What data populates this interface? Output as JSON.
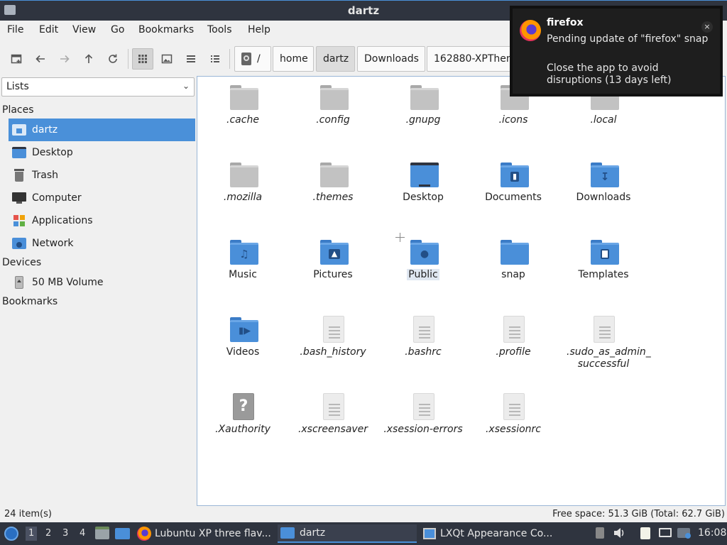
{
  "window": {
    "title": "dartz"
  },
  "menu": [
    "File",
    "Edit",
    "View",
    "Go",
    "Bookmarks",
    "Tools",
    "Help"
  ],
  "toolbar": {
    "breadcrumbs": [
      {
        "label": "/",
        "icon": "drive-icon"
      },
      {
        "label": "home"
      },
      {
        "label": "dartz",
        "current": true
      },
      {
        "label": "Downloads"
      },
      {
        "label": "162880-XPThem"
      }
    ]
  },
  "side": {
    "select_value": "Lists",
    "places_heading": "Places",
    "places": [
      "dartz",
      "Desktop",
      "Trash",
      "Computer",
      "Applications",
      "Network"
    ],
    "devices_heading": "Devices",
    "devices": [
      "50 MB Volume"
    ],
    "bookmarks_heading": "Bookmarks"
  },
  "files": [
    {
      "name": ".cache",
      "type": "folder-grey"
    },
    {
      "name": ".config",
      "type": "folder-grey"
    },
    {
      "name": ".gnupg",
      "type": "folder-grey"
    },
    {
      "name": ".icons",
      "type": "folder-grey"
    },
    {
      "name": ".local",
      "type": "folder-grey"
    },
    {
      "name": ".mozilla",
      "type": "folder-grey"
    },
    {
      "name": ".themes",
      "type": "folder-grey"
    },
    {
      "name": "Desktop",
      "type": "folder-desktop"
    },
    {
      "name": "Documents",
      "type": "folder-documents"
    },
    {
      "name": "Downloads",
      "type": "folder-downloads"
    },
    {
      "name": "Music",
      "type": "folder-music"
    },
    {
      "name": "Pictures",
      "type": "folder-pictures"
    },
    {
      "name": "Public",
      "type": "folder-public"
    },
    {
      "name": "snap",
      "type": "folder-blue"
    },
    {
      "name": "Templates",
      "type": "folder-templates"
    },
    {
      "name": "Videos",
      "type": "folder-videos"
    },
    {
      "name": ".bash_history",
      "type": "text-file"
    },
    {
      "name": ".bashrc",
      "type": "text-file"
    },
    {
      "name": ".profile",
      "type": "text-file"
    },
    {
      "name": ".sudo_as_admin_ successful",
      "type": "text-file"
    },
    {
      "name": ".Xauthority",
      "type": "unknown-file"
    },
    {
      "name": ".xscreensaver",
      "type": "text-file"
    },
    {
      "name": ".xsession-errors",
      "type": "text-file"
    },
    {
      "name": ".xsessionrc",
      "type": "text-file"
    }
  ],
  "status": {
    "count": "24 item(s)",
    "free": "Free space: 51.3 GiB (Total: 62.7 GiB)"
  },
  "taskbar": {
    "workspaces": [
      "1",
      "2",
      "3",
      "4"
    ],
    "tasks": [
      {
        "label": "Lubuntu XP three flav...",
        "icon": "firefox-icon"
      },
      {
        "label": "dartz",
        "icon": "folder-icon"
      },
      {
        "label": "LXQt Appearance Co...",
        "icon": "settings-icon"
      }
    ],
    "clock": "16:08"
  },
  "notification": {
    "title": "firefox",
    "line1": "Pending update of \"firefox\" snap",
    "line2": "Close the app to avoid disruptions (13 days left)",
    "close": "×"
  },
  "colors": {
    "accent": "#4a90d9",
    "titlebar": "#2f343f",
    "folder_blue": "#4a8fd9",
    "folder_grey": "#c2c2c2"
  }
}
